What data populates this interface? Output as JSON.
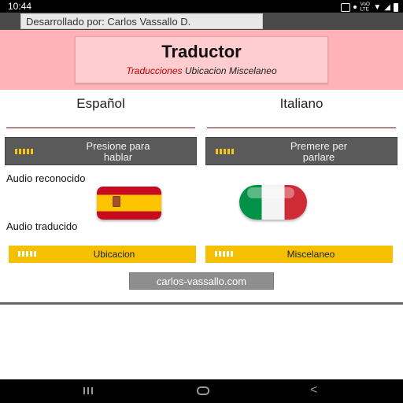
{
  "status_bar": {
    "time": "10:44",
    "lte_top": "VoO",
    "lte_bottom": "LTE"
  },
  "app_bar": {
    "developer": "Desarrollado por: Carlos Vassallo D."
  },
  "header": {
    "title": "Traductor",
    "nav": {
      "translations": "Traducciones",
      "location": "Ubicacion",
      "misc": "Miscelaneo"
    }
  },
  "languages": {
    "source": "Español",
    "target": "Italiano"
  },
  "speak_buttons": {
    "source_line1": "Presione para",
    "source_line2": "hablar",
    "target_line1": "Premere per",
    "target_line2": "parlare"
  },
  "audio": {
    "recognized": "Audio reconocido",
    "translated": "Audio traducido"
  },
  "actions": {
    "location": "Ubicacion",
    "misc": "Miscelaneo",
    "website": "carlos-vassallo.com"
  },
  "colors": {
    "header_bg": "#ffb3b8",
    "active_nav": "#c00000",
    "accent_yellow": "#f5c000",
    "button_dark": "#5a5a5a"
  }
}
